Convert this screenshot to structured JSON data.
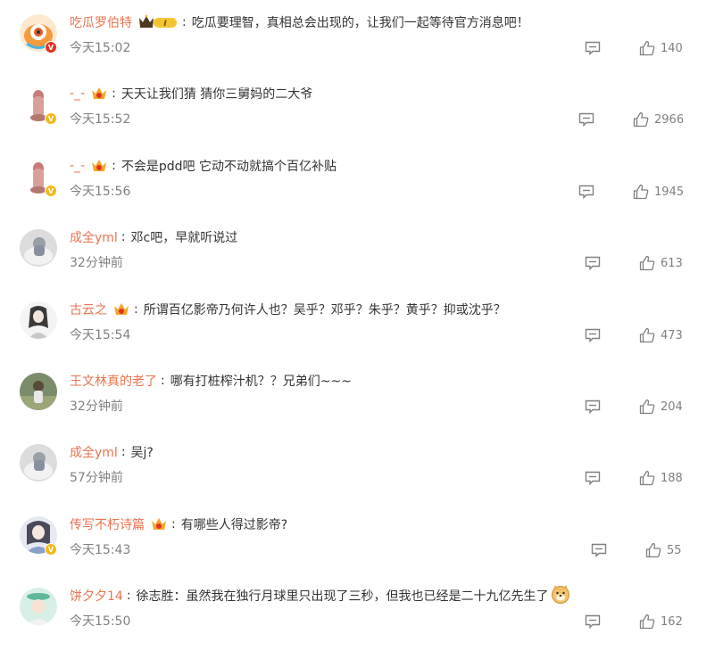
{
  "comments": [
    {
      "username": "吃瓜罗伯特",
      "vip_level": "I",
      "text": "吃瓜要理智，真相总会出现的，让我们一起等待官方消息吧！",
      "time": "今天15:02",
      "likes": "140",
      "badge": "red"
    },
    {
      "username": "-_-",
      "vip_level": "",
      "text": "天天让我们猜 猜你三舅妈的二大爷",
      "time": "今天15:52",
      "likes": "2966",
      "badge": "gold"
    },
    {
      "username": "-_-",
      "vip_level": "",
      "text": "不会是pdd吧 它动不动就搞个百亿补贴",
      "time": "今天15:56",
      "likes": "1945",
      "badge": "gold"
    },
    {
      "username": "成全yml",
      "vip_level": "",
      "text": "邓c吧，早就听说过",
      "time": "32分钟前",
      "likes": "613",
      "badge": ""
    },
    {
      "username": "古云之",
      "vip_level": "",
      "text": "所谓百亿影帝乃何许人也？吴乎？邓乎？朱乎？黄乎？抑或沈乎？",
      "time": "今天15:54",
      "likes": "473",
      "badge": ""
    },
    {
      "username": "王文林真的老了",
      "vip_level": "",
      "text": "哪有打桩榨汁机？？兄弟们~~~",
      "time": "32分钟前",
      "likes": "204",
      "badge": ""
    },
    {
      "username": "成全yml",
      "vip_level": "",
      "text": "吴j?",
      "time": "57分钟前",
      "likes": "188",
      "badge": ""
    },
    {
      "username": "传写不朽诗篇",
      "vip_level": "",
      "text": "有哪些人得过影帝?",
      "time": "今天15:43",
      "likes": "55",
      "badge": "gold"
    },
    {
      "username": "饼夕夕14",
      "vip_level": "",
      "text": "徐志胜：虽然我在独行月球里只出现了三秒，但我也已经是二十九亿先生了",
      "time": "今天15:50",
      "likes": "162",
      "badge": ""
    }
  ],
  "colors": {
    "username": "#eb7350",
    "text": "#333333",
    "meta": "#808080",
    "badge_red": "#e2341f",
    "badge_gold": "#f4b81c"
  },
  "icons": {
    "reply": "comment-icon",
    "like": "thumbs-up-icon",
    "vip": "crown-icon",
    "emoji": "doge-emoji-icon"
  }
}
